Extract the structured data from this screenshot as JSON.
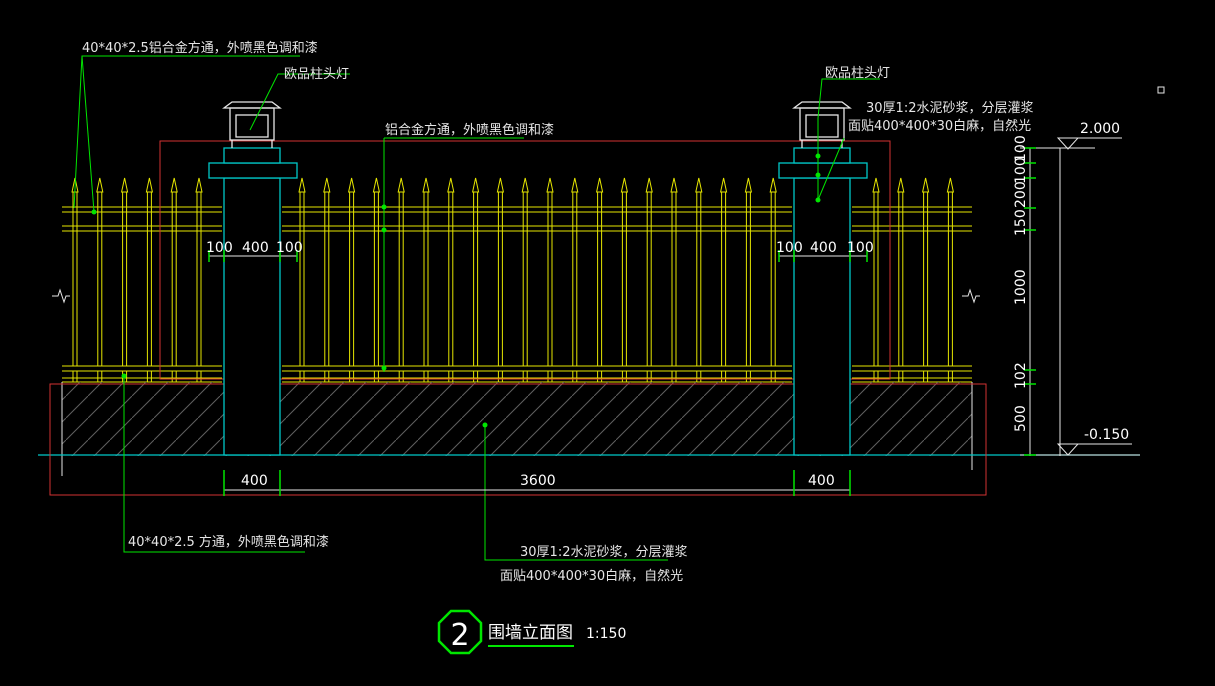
{
  "drawing": {
    "title": "围墙立面图",
    "scale": "1:150",
    "number": "2"
  },
  "annotations": {
    "top_left_tube": "40*40*2.5铝合金方通，外喷黑色调和漆",
    "bottom_left_tube": "40*40*2.5 方通，外喷黑色调和漆",
    "pillar_light_left": "欧品柱头灯",
    "pillar_light_right": "欧品柱头灯",
    "center_tube": "铝合金方通，外喷黑色调和漆",
    "cap_mortar": "30厚1:2水泥砂浆，分层灌浆",
    "cap_finish": "面贴400*400*30白麻，自然光",
    "base_mortar": "30厚1:2水泥砂浆，分层灌浆",
    "base_finish": "面贴400*400*30白麻，自然光"
  },
  "dimensions": {
    "pillar_left": [
      "100",
      "400",
      "100"
    ],
    "pillar_right": [
      "100",
      "400",
      "100"
    ],
    "bottom": [
      "400",
      "3600",
      "400"
    ],
    "vertical": [
      "100",
      "100",
      "200",
      "150",
      "1000",
      "102",
      "500"
    ],
    "elev_top": "2.000",
    "elev_bottom": "-0.150"
  },
  "colors": {
    "background": "#000000",
    "fence": "#e6e600",
    "pillar": "#00c8c8",
    "leader": "#00e600",
    "red_box": "#d23232",
    "text": "#e6e6e6"
  }
}
